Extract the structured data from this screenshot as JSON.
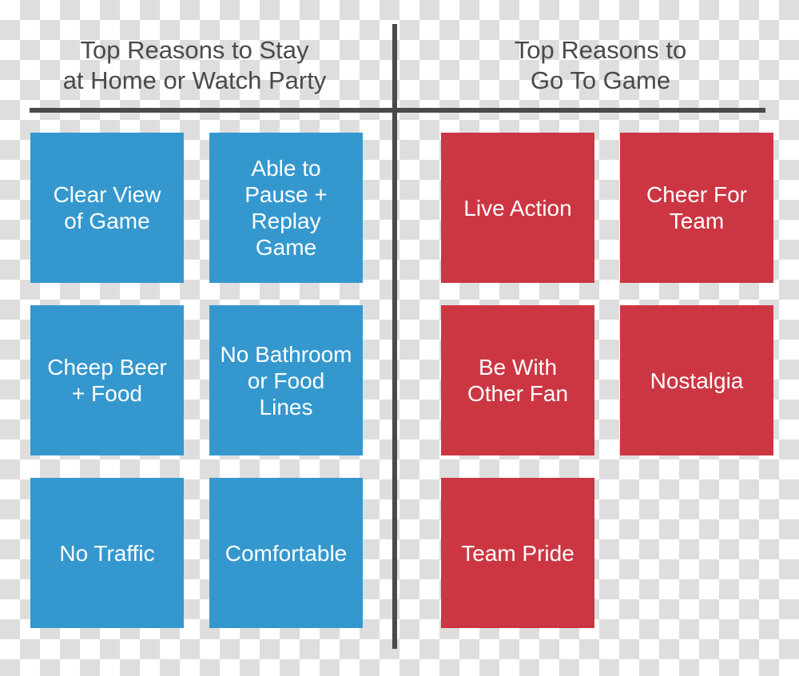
{
  "columns": [
    {
      "id": "stay-home",
      "header": "Top Reasons to Stay\nat Home or Watch Party",
      "color": "#3498ce",
      "cards": [
        "Clear View\nof Game",
        "Able to\nPause +\nReplay\nGame",
        "Cheep Beer\n+ Food",
        "No Bathroom\nor Food\nLines",
        "No Traffic",
        "Comfortable"
      ]
    },
    {
      "id": "go-to-game",
      "header": "Top Reasons to\nGo To Game",
      "color": "#cc3643",
      "cards": [
        "Live Action",
        "Cheer For\nTeam",
        "Be With\nOther Fan",
        "Nostalgia",
        "Team Pride",
        ""
      ]
    }
  ],
  "style": {
    "divider_color": "#4a4a4a",
    "header_text_color": "#4a4a4a",
    "card_text_color": "#ffffff",
    "background": "transparent-checkerboard"
  }
}
